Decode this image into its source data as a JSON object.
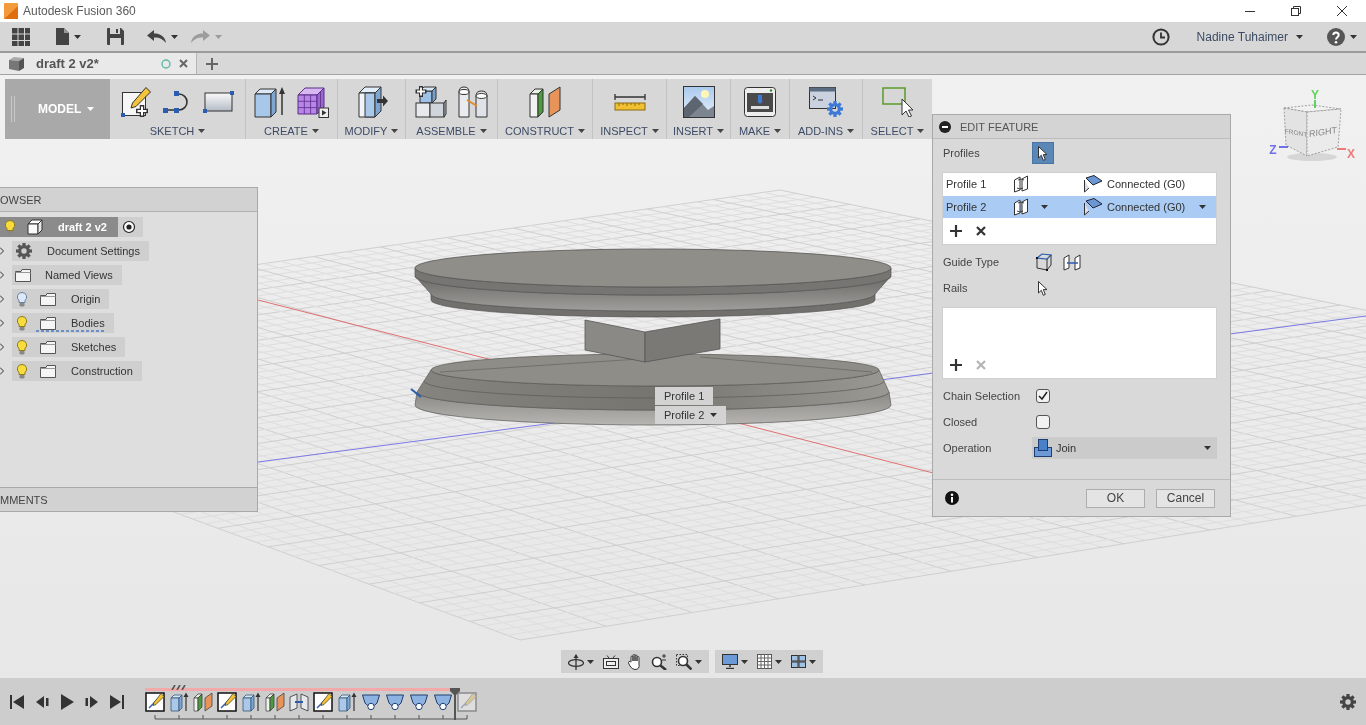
{
  "window": {
    "title": "Autodesk Fusion 360"
  },
  "app_bar": {
    "user": "Nadine Tuhaimer"
  },
  "document_tabs": [
    {
      "label": "draft 2 v2*",
      "selected": true
    }
  ],
  "toolbar": {
    "workspace": "MODEL",
    "groups": [
      {
        "label": "SKETCH",
        "kind": "sketch"
      },
      {
        "label": "CREATE",
        "kind": "create"
      },
      {
        "label": "MODIFY",
        "kind": "modify"
      },
      {
        "label": "ASSEMBLE",
        "kind": "assemble"
      },
      {
        "label": "CONSTRUCT",
        "kind": "construct"
      },
      {
        "label": "INSPECT",
        "kind": "inspect"
      },
      {
        "label": "INSERT",
        "kind": "insert"
      },
      {
        "label": "MAKE",
        "kind": "make"
      },
      {
        "label": "ADD-INS",
        "kind": "addins"
      },
      {
        "label": "SELECT",
        "kind": "select"
      }
    ]
  },
  "browser": {
    "title": "OWSER",
    "root": {
      "label": "draft 2 v2",
      "visible": true,
      "active": true,
      "children": [
        {
          "label": "Document Settings",
          "kind": "settings"
        },
        {
          "label": "Named Views",
          "kind": "views"
        },
        {
          "label": "Origin",
          "kind": "folder",
          "visible": false,
          "underlined": false
        },
        {
          "label": "Bodies",
          "kind": "folder",
          "visible": true,
          "underlined": true
        },
        {
          "label": "Sketches",
          "kind": "folder",
          "visible": true,
          "underlined": false
        },
        {
          "label": "Construction",
          "kind": "folder",
          "visible": true,
          "underlined": false
        }
      ]
    },
    "comments_title": "MMENTS"
  },
  "viewport": {
    "callouts": [
      {
        "label": "Profile 1",
        "dropdown": false
      },
      {
        "label": "Profile 2",
        "dropdown": true
      }
    ],
    "view_cube": {
      "faces": [
        "FRONT",
        "RIGHT"
      ],
      "axes": [
        {
          "label": "Y",
          "color": "#5fd35f"
        },
        {
          "label": "Z",
          "color": "#6f6fe8"
        },
        {
          "label": "X",
          "color": "#ef7a7a"
        }
      ]
    }
  },
  "edit_feature": {
    "title": "EDIT FEATURE",
    "profiles": {
      "label": "Profiles",
      "select_active": true,
      "items": [
        {
          "name": "Profile 1",
          "continuity": "Connected (G0)",
          "selected": false
        },
        {
          "name": "Profile 2",
          "continuity": "Connected (G0)",
          "selected": true
        }
      ],
      "remove_disabled": false
    },
    "guide_type": {
      "label": "Guide Type"
    },
    "rails": {
      "label": "Rails",
      "select_active": false,
      "remove_disabled": true
    },
    "options": [
      {
        "label": "Chain Selection",
        "checked": true
      },
      {
        "label": "Closed",
        "checked": false
      }
    ],
    "operation": {
      "label": "Operation",
      "value": "Join"
    },
    "buttons": [
      {
        "label": "OK"
      },
      {
        "label": "Cancel"
      }
    ]
  },
  "timeline": {
    "features": [
      {
        "kind": "sketch",
        "rolled_back": false
      },
      {
        "kind": "extrude",
        "rolled_back": false
      },
      {
        "kind": "plane",
        "rolled_back": false
      },
      {
        "kind": "sketch",
        "rolled_back": false
      },
      {
        "kind": "extrude",
        "rolled_back": false
      },
      {
        "kind": "plane",
        "rolled_back": false
      },
      {
        "kind": "joint",
        "rolled_back": false
      },
      {
        "kind": "sketch",
        "rolled_back": false
      },
      {
        "kind": "extrude",
        "rolled_back": false
      },
      {
        "kind": "loft",
        "rolled_back": false
      },
      {
        "kind": "loft",
        "rolled_back": false
      },
      {
        "kind": "loft",
        "rolled_back": false
      },
      {
        "kind": "loft",
        "rolled_back": false
      },
      {
        "kind": "sketch",
        "rolled_back": true
      }
    ]
  }
}
